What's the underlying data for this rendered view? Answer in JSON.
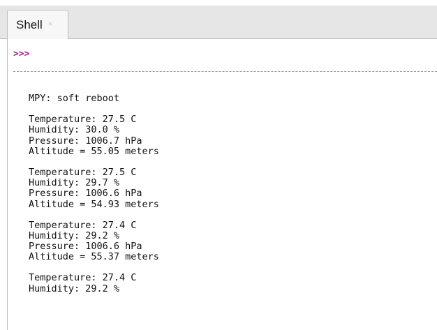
{
  "tabs": [
    {
      "label": "Shell",
      "close_glyph": "×"
    }
  ],
  "shell": {
    "prompt": ">>>",
    "reboot_line": "MPY: soft reboot",
    "readings": [
      {
        "temperature": "Temperature: 27.5 C",
        "humidity": "Humidity: 30.0 %",
        "pressure": "Pressure: 1006.7 hPa",
        "altitude": "Altitude = 55.05 meters"
      },
      {
        "temperature": "Temperature: 27.5 C",
        "humidity": "Humidity: 29.7 %",
        "pressure": "Pressure: 1006.6 hPa",
        "altitude": "Altitude = 54.93 meters"
      },
      {
        "temperature": "Temperature: 27.4 C",
        "humidity": "Humidity: 29.2 %",
        "pressure": "Pressure: 1006.6 hPa",
        "altitude": "Altitude = 55.37 meters"
      },
      {
        "temperature": "Temperature: 27.4 C",
        "humidity": "Humidity: 29.2 %"
      }
    ]
  },
  "colors": {
    "prompt": "#9b1c8f",
    "tabbar_bg": "#e6e6e6"
  }
}
